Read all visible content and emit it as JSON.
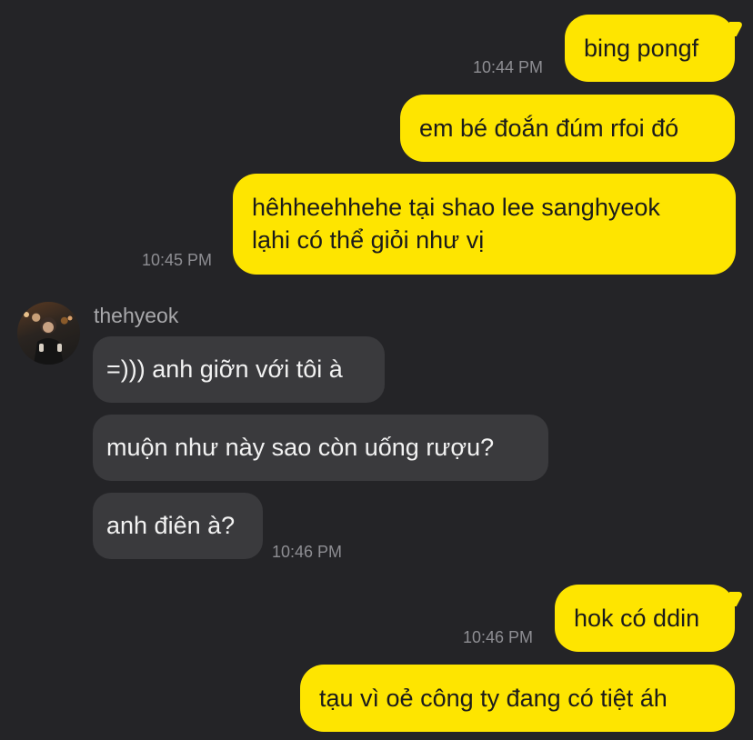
{
  "contact": {
    "name": "thehyeok"
  },
  "messages": [
    {
      "from": "me",
      "text": "bing pongf",
      "time": "10:44 PM"
    },
    {
      "from": "me",
      "text": "em bé đoắn đúm rfoi đó"
    },
    {
      "from": "me",
      "lines": [
        "hêhheehhehe tại shao lee sanghyeok",
        "lạhi có thể giỏi như vị"
      ],
      "time": "10:45 PM"
    },
    {
      "from": "them",
      "text": "=))) anh giỡn với tôi à"
    },
    {
      "from": "them",
      "text": "muộn như này sao còn uống rượu?"
    },
    {
      "from": "them",
      "text": "anh điên à?",
      "time": "10:46 PM"
    },
    {
      "from": "me",
      "text": "hok có ddin",
      "time": "10:46 PM"
    },
    {
      "from": "me",
      "text": "tạu vì oẻ công ty đang có tiệt áh"
    }
  ],
  "colors": {
    "background": "#242427",
    "outgoing_bubble": "#FEE500",
    "incoming_bubble": "#3a3a3d",
    "timestamp": "#8e8e93"
  },
  "icons": {
    "avatar": "contact-profile-photo"
  }
}
